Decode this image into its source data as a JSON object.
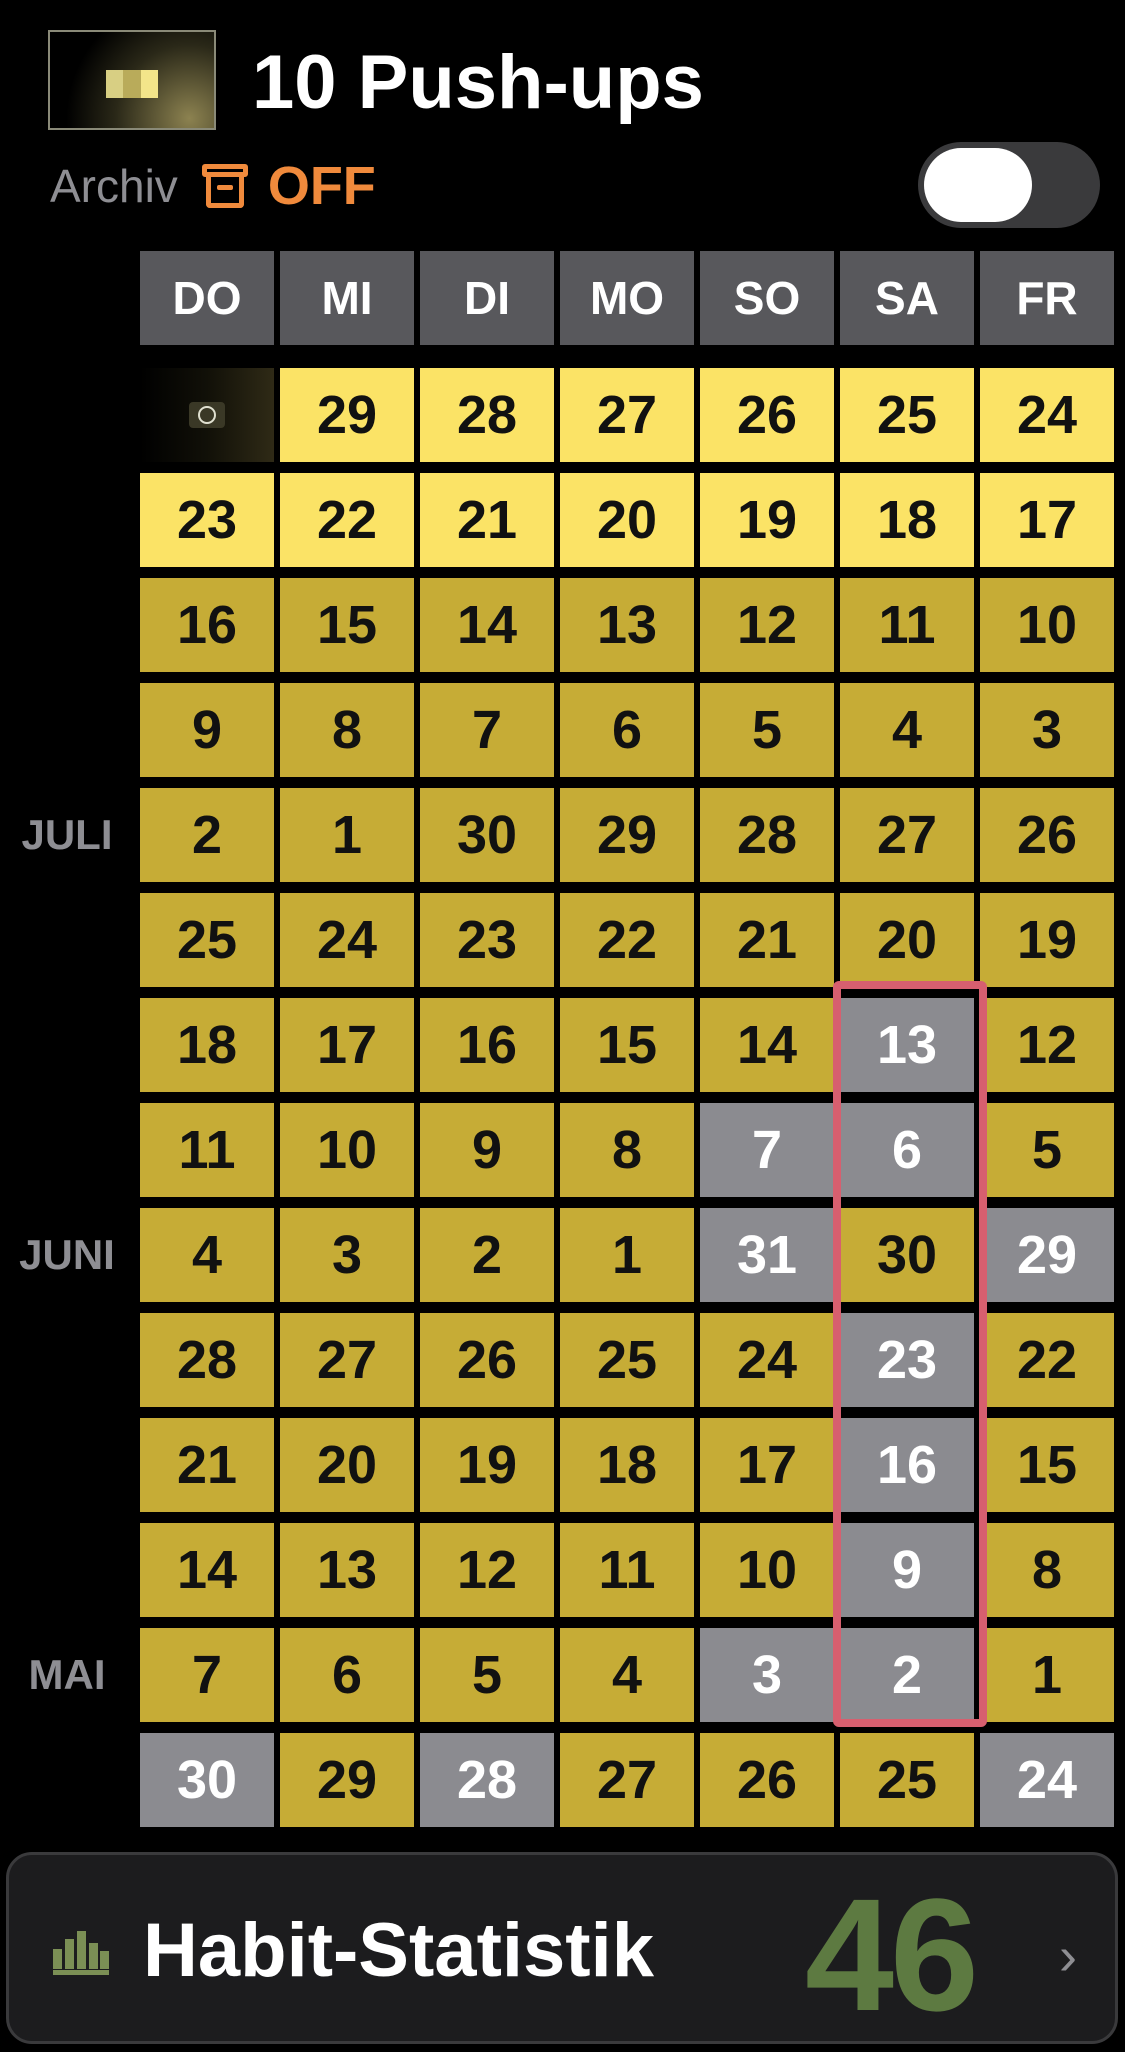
{
  "header": {
    "title": "10 Push-ups",
    "thumb_colors": [
      "#d8cf83",
      "#b9ab5a",
      "#f3e58a"
    ]
  },
  "archive": {
    "label": "Archiv",
    "icon": "archive-box-icon",
    "state": "OFF",
    "toggle_on": false
  },
  "weekdays": [
    "DO",
    "MI",
    "DI",
    "MO",
    "SO",
    "SA",
    "FR"
  ],
  "months": [
    {
      "row": 4,
      "label": "JULI"
    },
    {
      "row": 8,
      "label": "JUNI"
    },
    {
      "row": 12,
      "label": "MAI"
    }
  ],
  "grid": [
    [
      {
        "d": "",
        "s": "today"
      },
      {
        "d": "29",
        "s": "bright"
      },
      {
        "d": "28",
        "s": "bright"
      },
      {
        "d": "27",
        "s": "bright"
      },
      {
        "d": "26",
        "s": "bright"
      },
      {
        "d": "25",
        "s": "bright"
      },
      {
        "d": "24",
        "s": "bright"
      }
    ],
    [
      {
        "d": "23",
        "s": "bright"
      },
      {
        "d": "22",
        "s": "bright"
      },
      {
        "d": "21",
        "s": "bright"
      },
      {
        "d": "20",
        "s": "bright"
      },
      {
        "d": "19",
        "s": "bright"
      },
      {
        "d": "18",
        "s": "bright"
      },
      {
        "d": "17",
        "s": "bright"
      }
    ],
    [
      {
        "d": "16",
        "s": "done"
      },
      {
        "d": "15",
        "s": "done"
      },
      {
        "d": "14",
        "s": "done"
      },
      {
        "d": "13",
        "s": "done"
      },
      {
        "d": "12",
        "s": "done"
      },
      {
        "d": "11",
        "s": "done"
      },
      {
        "d": "10",
        "s": "done"
      }
    ],
    [
      {
        "d": "9",
        "s": "done"
      },
      {
        "d": "8",
        "s": "done"
      },
      {
        "d": "7",
        "s": "done"
      },
      {
        "d": "6",
        "s": "done"
      },
      {
        "d": "5",
        "s": "done"
      },
      {
        "d": "4",
        "s": "done"
      },
      {
        "d": "3",
        "s": "done"
      }
    ],
    [
      {
        "d": "2",
        "s": "done"
      },
      {
        "d": "1",
        "s": "done"
      },
      {
        "d": "30",
        "s": "done"
      },
      {
        "d": "29",
        "s": "done"
      },
      {
        "d": "28",
        "s": "done"
      },
      {
        "d": "27",
        "s": "done"
      },
      {
        "d": "26",
        "s": "done"
      }
    ],
    [
      {
        "d": "25",
        "s": "done"
      },
      {
        "d": "24",
        "s": "done"
      },
      {
        "d": "23",
        "s": "done"
      },
      {
        "d": "22",
        "s": "done"
      },
      {
        "d": "21",
        "s": "done"
      },
      {
        "d": "20",
        "s": "done"
      },
      {
        "d": "19",
        "s": "done"
      }
    ],
    [
      {
        "d": "18",
        "s": "done"
      },
      {
        "d": "17",
        "s": "done"
      },
      {
        "d": "16",
        "s": "done"
      },
      {
        "d": "15",
        "s": "done"
      },
      {
        "d": "14",
        "s": "done"
      },
      {
        "d": "13",
        "s": "miss"
      },
      {
        "d": "12",
        "s": "done"
      }
    ],
    [
      {
        "d": "11",
        "s": "done"
      },
      {
        "d": "10",
        "s": "done"
      },
      {
        "d": "9",
        "s": "done"
      },
      {
        "d": "8",
        "s": "done"
      },
      {
        "d": "7",
        "s": "miss"
      },
      {
        "d": "6",
        "s": "miss"
      },
      {
        "d": "5",
        "s": "done"
      }
    ],
    [
      {
        "d": "4",
        "s": "done"
      },
      {
        "d": "3",
        "s": "done"
      },
      {
        "d": "2",
        "s": "done"
      },
      {
        "d": "1",
        "s": "done"
      },
      {
        "d": "31",
        "s": "miss"
      },
      {
        "d": "30",
        "s": "done"
      },
      {
        "d": "29",
        "s": "miss"
      }
    ],
    [
      {
        "d": "28",
        "s": "done"
      },
      {
        "d": "27",
        "s": "done"
      },
      {
        "d": "26",
        "s": "done"
      },
      {
        "d": "25",
        "s": "done"
      },
      {
        "d": "24",
        "s": "done"
      },
      {
        "d": "23",
        "s": "miss"
      },
      {
        "d": "22",
        "s": "done"
      }
    ],
    [
      {
        "d": "21",
        "s": "done"
      },
      {
        "d": "20",
        "s": "done"
      },
      {
        "d": "19",
        "s": "done"
      },
      {
        "d": "18",
        "s": "done"
      },
      {
        "d": "17",
        "s": "done"
      },
      {
        "d": "16",
        "s": "miss"
      },
      {
        "d": "15",
        "s": "done"
      }
    ],
    [
      {
        "d": "14",
        "s": "done"
      },
      {
        "d": "13",
        "s": "done"
      },
      {
        "d": "12",
        "s": "done"
      },
      {
        "d": "11",
        "s": "done"
      },
      {
        "d": "10",
        "s": "done"
      },
      {
        "d": "9",
        "s": "miss"
      },
      {
        "d": "8",
        "s": "done"
      }
    ],
    [
      {
        "d": "7",
        "s": "done"
      },
      {
        "d": "6",
        "s": "done"
      },
      {
        "d": "5",
        "s": "done"
      },
      {
        "d": "4",
        "s": "done"
      },
      {
        "d": "3",
        "s": "miss"
      },
      {
        "d": "2",
        "s": "miss"
      },
      {
        "d": "1",
        "s": "done"
      }
    ],
    [
      {
        "d": "30",
        "s": "miss"
      },
      {
        "d": "29",
        "s": "done"
      },
      {
        "d": "28",
        "s": "miss"
      },
      {
        "d": "27",
        "s": "done"
      },
      {
        "d": "26",
        "s": "done"
      },
      {
        "d": "25",
        "s": "done"
      },
      {
        "d": "24",
        "s": "miss"
      }
    ]
  ],
  "colors": {
    "bright": "#fbe366",
    "done": "#c6ac36",
    "miss": "#8b8b90",
    "highlight": "#d75f6f",
    "stat_value": "#5d7a41",
    "accent": "#f08a3c"
  },
  "stats": {
    "icon": "bar-chart-icon",
    "label": "Habit-Statistik",
    "value": "46",
    "chevron": "›"
  }
}
